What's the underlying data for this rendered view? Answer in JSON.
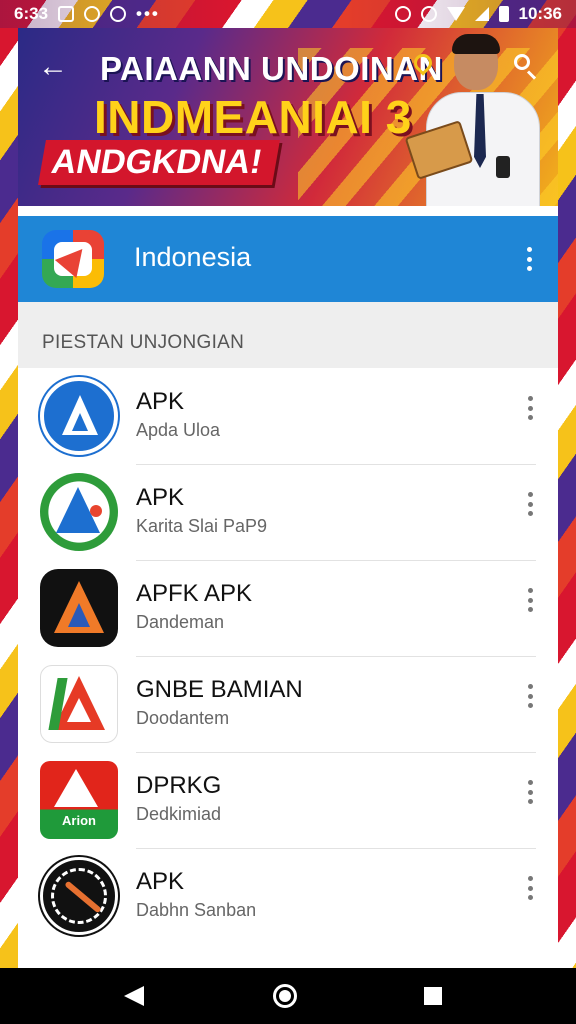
{
  "status_bar": {
    "time_left": "6:33",
    "time_right": "10:36"
  },
  "banner": {
    "line1": "PAIAANN UNDOINAN",
    "line2": "INDMEANIAI 3",
    "line3": "ANDGKDNA!"
  },
  "country": {
    "title": "Indonesia"
  },
  "section": {
    "title": "PIESTAN UNJONGIAN"
  },
  "apps": [
    {
      "name": "APK",
      "subtitle": "Apda Uloa",
      "icon": "shield-a-icon"
    },
    {
      "name": "APK",
      "subtitle": "Karita Slai PaP9",
      "icon": "green-star-a-icon"
    },
    {
      "name": "APFK APK",
      "subtitle": "Dandeman",
      "icon": "orange-a-icon"
    },
    {
      "name": "GNBE BAMIAN",
      "subtitle": "Doodantem",
      "icon": "red-a-icon"
    },
    {
      "name": "DPRKG",
      "subtitle": "Dedkimiad",
      "icon": "red-green-a-icon"
    },
    {
      "name": "APK",
      "subtitle": "Dabhn Sanban",
      "icon": "compass-icon"
    }
  ],
  "icon5_label": "Arion",
  "colors": {
    "country_bar": "#1f86d6",
    "banner_yellow": "#ffd21a",
    "banner_red": "#d3162c"
  }
}
